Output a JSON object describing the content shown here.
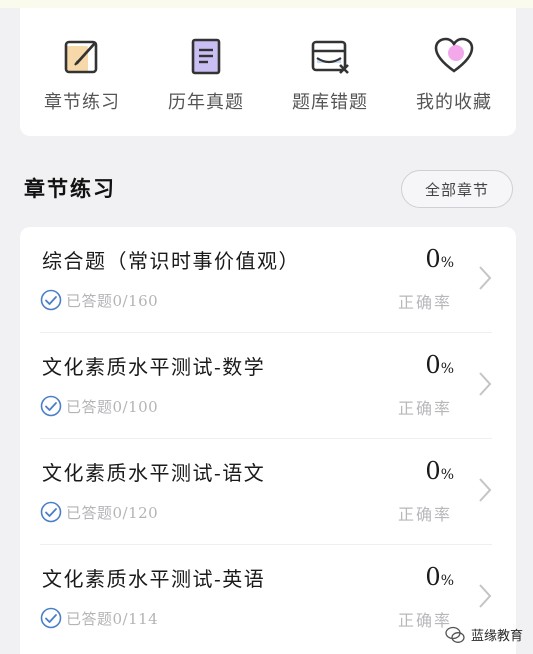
{
  "quick_menu": [
    {
      "label": "章节练习",
      "icon": "edit-note-icon"
    },
    {
      "label": "历年真题",
      "icon": "document-icon"
    },
    {
      "label": "题库错题",
      "icon": "wrong-questions-icon"
    },
    {
      "label": "我的收藏",
      "icon": "heart-icon"
    }
  ],
  "section": {
    "title": "章节练习",
    "all_button": "全部章节"
  },
  "chapters": [
    {
      "title": "综合题（常识时事价值观）",
      "answered": "已答题0/160",
      "rate": "0",
      "rate_symbol": "%",
      "rate_label": "正确率"
    },
    {
      "title": "文化素质水平测试-数学",
      "answered": "已答题0/100",
      "rate": "0",
      "rate_symbol": "%",
      "rate_label": "正确率"
    },
    {
      "title": "文化素质水平测试-语文",
      "answered": "已答题0/120",
      "rate": "0",
      "rate_symbol": "%",
      "rate_label": "正确率"
    },
    {
      "title": "文化素质水平测试-英语",
      "answered": "已答题0/114",
      "rate": "0",
      "rate_symbol": "%",
      "rate_label": "正确率"
    }
  ],
  "watermark": {
    "text": "蓝缘教育"
  },
  "colors": {
    "background": "#f1f1f3",
    "card": "#ffffff",
    "accent_blue": "#4a7fc8",
    "icon_orange": "#f7d8a8",
    "icon_purple": "#c9bff2",
    "heart_pink": "#f2a8ea"
  }
}
